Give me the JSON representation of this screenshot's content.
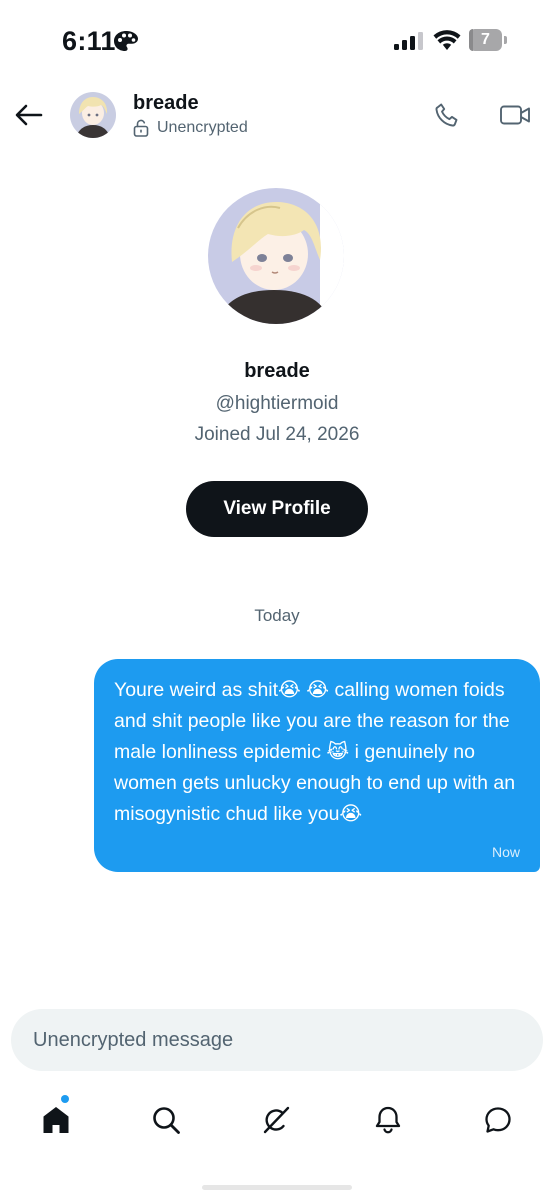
{
  "status_bar": {
    "time": "6:11",
    "battery_level": "7",
    "icons": [
      "palette-icon",
      "cellular-signal-icon",
      "wifi-icon",
      "battery-icon"
    ]
  },
  "header": {
    "name": "breade",
    "encryption_status": "Unencrypted",
    "icons": [
      "back-arrow-icon",
      "lock-open-icon",
      "phone-icon",
      "video-camera-icon"
    ]
  },
  "profile": {
    "name": "breade",
    "handle": "@hightiermoid",
    "joined": "Joined Jul 24, 2026",
    "view_profile_label": "View Profile"
  },
  "conversation": {
    "day_label": "Today",
    "messages": [
      {
        "text": "Youre weird as shit😭 😭 calling women foids and shit people like you are the reason for the male lonliness epidemic 😹 i genuinely no women gets unlucky enough to end up with an misogynistic chud like you😭",
        "time": "Now",
        "direction": "outgoing"
      }
    ]
  },
  "composer": {
    "placeholder": "Unencrypted message",
    "value": ""
  },
  "bottom_nav": {
    "items": [
      "home-icon",
      "search-icon",
      "grok-icon",
      "notifications-icon",
      "messages-icon"
    ],
    "active": "home-icon"
  },
  "colors": {
    "accent": "#1d9bf0",
    "text_primary": "#0f1419",
    "text_secondary": "#536471",
    "composer_bg": "#eff3f4"
  }
}
